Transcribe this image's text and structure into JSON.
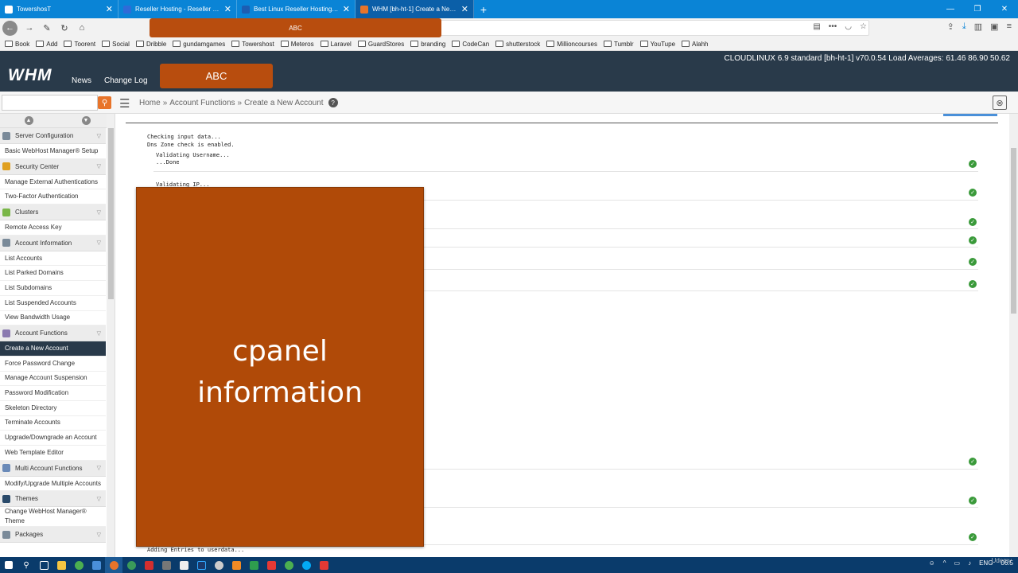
{
  "browser": {
    "tabs": [
      {
        "title": "TowershosT",
        "active": false,
        "favicon_color": "#ffffff"
      },
      {
        "title": "Reseller Hosting - Reseller Hos",
        "active": false,
        "favicon_color": "#2f6bd8"
      },
      {
        "title": "Best Linux Reseller Hosting Plan",
        "active": false,
        "favicon_color": "#1c5db2"
      },
      {
        "title": "WHM [bh-ht-1] Create a New A",
        "active": true,
        "favicon_color": "#e8742a"
      }
    ],
    "bookmarks": [
      "Book",
      "Add",
      "Toorent",
      "Social",
      "Dribble",
      "gundamgames",
      "Towershost",
      "Meteros",
      "Laravel",
      "GuardStores",
      "branding",
      "CodeCan",
      "shutterstock",
      "Millioncourses",
      "Tumblr",
      "YouTupe",
      "Alahh"
    ]
  },
  "annotation": {
    "small_label": "ABC",
    "header_label": "ABC",
    "big_label_line1": "cpanel",
    "big_label_line2": "information"
  },
  "whm": {
    "logo": "WHM",
    "nav": [
      "News",
      "Change Log"
    ],
    "server_info": "CLOUDLINUX 6.9 standard [bh-ht-1]    v70.0.54    Load Averages: 61.46 86.90 50.62"
  },
  "search": {
    "placeholder": ""
  },
  "breadcrumb": {
    "home": "Home",
    "section": "Account Functions",
    "page": "Create a New Account"
  },
  "sidebar": {
    "sections": [
      {
        "title": "Server Configuration",
        "icon": "server-icon",
        "color": "#7a8a99",
        "items": [
          "Basic WebHost Manager® Setup"
        ]
      },
      {
        "title": "Security Center",
        "icon": "lock-icon",
        "color": "#e0a020",
        "items": [
          "Manage External Authentications",
          "Two-Factor Authentication"
        ]
      },
      {
        "title": "Clusters",
        "icon": "clusters-icon",
        "color": "#7ab648",
        "items": [
          "Remote Access Key"
        ]
      },
      {
        "title": "Account Information",
        "icon": "account-info-icon",
        "color": "#7a8a99",
        "items": [
          "List Accounts",
          "List Parked Domains",
          "List Subdomains",
          "List Suspended Accounts",
          "View Bandwidth Usage"
        ]
      },
      {
        "title": "Account Functions",
        "icon": "user-icon",
        "color": "#8a7ab0",
        "items": [
          "Create a New Account",
          "Force Password Change",
          "Manage Account Suspension",
          "Password Modification",
          "Skeleton Directory",
          "Terminate Accounts",
          "Upgrade/Downgrade an Account",
          "Web Template Editor"
        ]
      },
      {
        "title": "Multi Account Functions",
        "icon": "multi-account-icon",
        "color": "#6a8ab8",
        "items": [
          "Modify/Upgrade Multiple Accounts"
        ]
      },
      {
        "title": "Themes",
        "icon": "themes-icon",
        "color": "#2a4a6a",
        "items": [
          "Change WebHost Manager® Theme"
        ]
      },
      {
        "title": "Packages",
        "icon": "packages-icon",
        "color": "#7a8a99",
        "items": []
      }
    ],
    "active_item": "Create a New Account"
  },
  "log": {
    "line1": "Checking input data...",
    "line2": "Dns Zone check is enabled.",
    "line3": "Validating Username...",
    "line4": "...Done",
    "line5": "Validating IP...",
    "last": "Adding Entries to userdata..."
  },
  "taskbar": {
    "lang": "ENG",
    "time": "06:5",
    "watermark": "Udemy"
  }
}
